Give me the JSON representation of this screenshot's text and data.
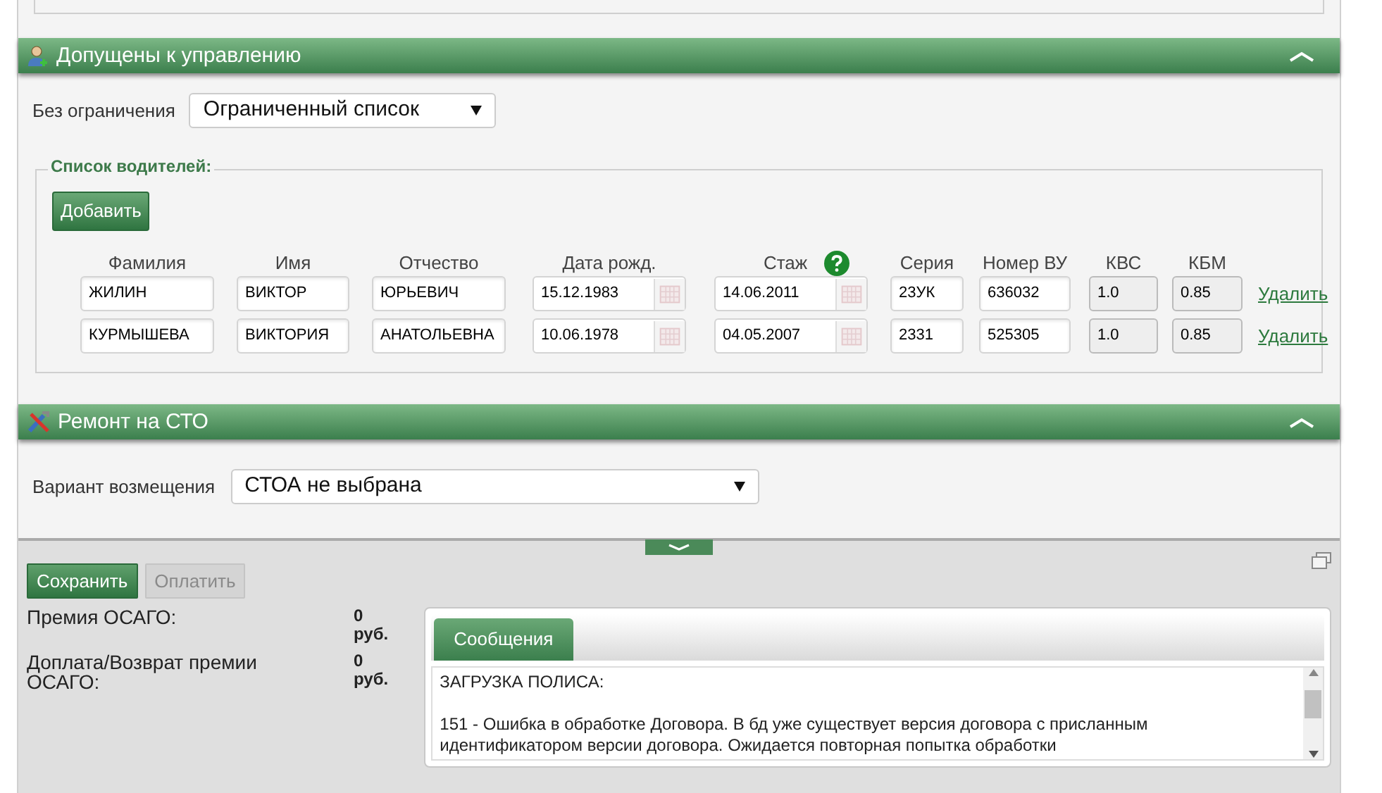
{
  "drivers_section": {
    "title": "Допущены к управлению",
    "expanded": true,
    "restriction": {
      "label": "Без ограничения",
      "value": "Ограниченный список"
    },
    "list": {
      "legend": "Список водителей:",
      "add_button": "Добавить",
      "columns": [
        "Фамилия",
        "Имя",
        "Отчество",
        "Дата рожд.",
        "Стаж",
        "Серия",
        "Номер ВУ",
        "КВС",
        "КБМ"
      ],
      "rows": [
        {
          "last_name": "ЖИЛИН",
          "first_name": "ВИКТОР",
          "patronymic": "ЮРЬЕВИЧ",
          "birth_date": "15.12.1983",
          "experience": "14.06.2011",
          "series": "23УК",
          "number": "636032",
          "kvs": "1.0",
          "kbm": "0.85",
          "delete": "Удалить"
        },
        {
          "last_name": "КУРМЫШЕВА",
          "first_name": "ВИКТОРИЯ",
          "patronymic": "АНАТОЛЬЕВНА",
          "birth_date": "10.06.1978",
          "experience": "04.05.2007",
          "series": "2331",
          "number": "525305",
          "kvs": "1.0",
          "kbm": "0.85",
          "delete": "Удалить"
        }
      ]
    }
  },
  "repair_section": {
    "title": "Ремонт на СТО",
    "expanded": true,
    "compensation": {
      "label": "Вариант возмещения",
      "value": "СТОА не выбрана"
    }
  },
  "bottom_panel": {
    "buttons": [
      {
        "label": "Сохранить",
        "disabled": false
      },
      {
        "label": "Оплатить",
        "disabled": true
      }
    ],
    "premiums": [
      {
        "label": "Премия ОСАГО:",
        "value": "0 руб."
      },
      {
        "label": "Доплата/Возврат премии ОСАГО:",
        "value": "0 руб."
      }
    ],
    "messages": {
      "tab": "Сообщения",
      "lines": [
        "ЗАГРУЗКА ПОЛИСА:",
        "151 - Ошибка в обработке Договора. В бд уже существует версия договора с присланным идентификатором версии договора. Ожидается повторная попытка обработки"
      ]
    }
  }
}
